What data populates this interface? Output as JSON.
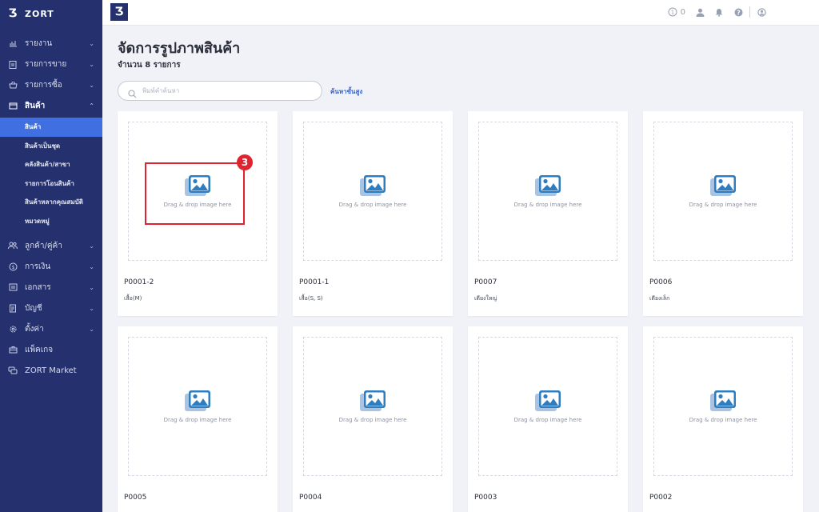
{
  "brand": {
    "name": "ZORT",
    "logo_glyph": "Ʒ"
  },
  "sidebar": {
    "items": [
      {
        "label": "รายงาน",
        "icon": "chart-icon"
      },
      {
        "label": "รายการขาย",
        "icon": "clipboard-icon"
      },
      {
        "label": "รายการซื้อ",
        "icon": "basket-icon"
      },
      {
        "label": "สินค้า",
        "icon": "box-icon"
      },
      {
        "label": "ลูกค้า/คู่ค้า",
        "icon": "users-icon"
      },
      {
        "label": "การเงิน",
        "icon": "coin-icon"
      },
      {
        "label": "เอกสาร",
        "icon": "document-icon"
      },
      {
        "label": "บัญชี",
        "icon": "ledger-icon"
      },
      {
        "label": "ตั้งค่า",
        "icon": "gear-icon"
      },
      {
        "label": "แพ็คเกจ",
        "icon": "package-icon"
      },
      {
        "label": "ZORT Market",
        "icon": "market-icon"
      }
    ],
    "submenu": [
      {
        "label": "สินค้า"
      },
      {
        "label": "สินค้าเป็นชุด"
      },
      {
        "label": "คลังสินค้า/สาขา"
      },
      {
        "label": "รายการโอนสินค้า"
      },
      {
        "label": "สินค้าหลากคุณสมบัติ"
      },
      {
        "label": "หมวดหมู่"
      }
    ]
  },
  "topbar": {
    "notification_count": "0"
  },
  "page": {
    "title": "จัดการรูปภาพสินค้า",
    "count_text": "จำนวน 8 รายการ",
    "search_placeholder": "พิมพ์คำค้นหา",
    "advanced_search": "ค้นหาขั้นสูง",
    "drop_text": "Drag & drop image here",
    "step_number": "3"
  },
  "products": [
    {
      "code": "P0001-2",
      "name": "เสื้อ(M)"
    },
    {
      "code": "P0001-1",
      "name": "เสื้อ(S, S)"
    },
    {
      "code": "P0007",
      "name": "เตียงใหญ่"
    },
    {
      "code": "P0006",
      "name": "เตียงเล็ก"
    },
    {
      "code": "P0005",
      "name": ""
    },
    {
      "code": "P0004",
      "name": ""
    },
    {
      "code": "P0003",
      "name": ""
    },
    {
      "code": "P0002",
      "name": ""
    }
  ],
  "colors": {
    "sidebar": "#25316e",
    "active": "#3f6fe0",
    "accent": "#3a63c5",
    "highlight": "#e0242f"
  }
}
